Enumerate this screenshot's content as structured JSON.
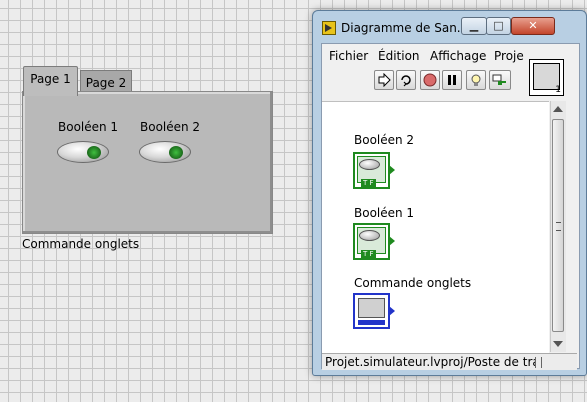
{
  "front_panel": {
    "tabs": [
      {
        "label": "Page 1",
        "active": true
      },
      {
        "label": "Page 2",
        "active": false
      }
    ],
    "booleans": [
      {
        "label": "Booléen 1"
      },
      {
        "label": "Booléen 2"
      }
    ],
    "tab_control_caption": "Commande onglets"
  },
  "diagram_window": {
    "title": "Diagramme de San...",
    "window_buttons": {
      "minimize": "▁",
      "maximize": "□",
      "close": "✕"
    },
    "menu": [
      {
        "label": "Fichier"
      },
      {
        "label": "Édition"
      },
      {
        "label": "Affichage"
      },
      {
        "label": "Proje"
      }
    ],
    "toolbar": [
      {
        "icon": "run-arrow-icon"
      },
      {
        "icon": "run-continuously-icon"
      },
      {
        "icon": "abort-icon"
      },
      {
        "icon": "pause-icon"
      },
      {
        "icon": "highlight-execution-icon"
      },
      {
        "icon": "retain-wire-values-icon"
      }
    ],
    "vi_icon_number": "1",
    "terminals": [
      {
        "label": "Booléen 2",
        "type": "boolean"
      },
      {
        "label": "Booléen 1",
        "type": "boolean"
      },
      {
        "label": "Commande onglets",
        "type": "tab"
      }
    ],
    "status_text": "Projet.simulateur.lvproj/Poste de trav"
  },
  "colors": {
    "boolean_green": "#1f8a1f",
    "tab_blue": "#2234c9"
  }
}
